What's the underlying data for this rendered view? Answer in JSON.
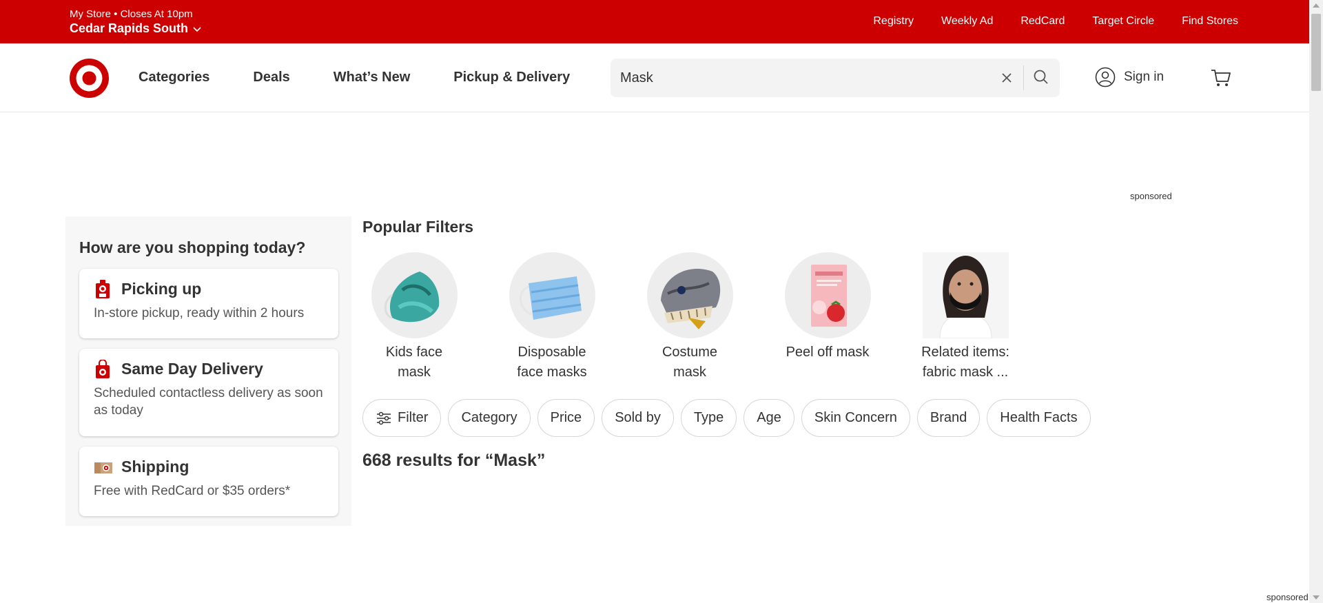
{
  "store": {
    "line1": "My Store • Closes At 10pm",
    "name": "Cedar Rapids South"
  },
  "utility_links": [
    "Registry",
    "Weekly Ad",
    "RedCard",
    "Target Circle",
    "Find Stores"
  ],
  "nav": {
    "items": [
      "Categories",
      "Deals",
      "What’s New",
      "Pickup & Delivery"
    ]
  },
  "search": {
    "value": "Mask"
  },
  "account": {
    "signin_label": "Sign in"
  },
  "sponsored": {
    "top": "sponsored",
    "bottom": "sponsored"
  },
  "shopping": {
    "title": "How are you shopping today?",
    "options": [
      {
        "title": "Picking up",
        "desc": "In-store pickup, ready within 2 hours"
      },
      {
        "title": "Same Day Delivery",
        "desc": "Scheduled contactless delivery as soon as today"
      },
      {
        "title": "Shipping",
        "desc": "Free with RedCard or $35 orders*"
      }
    ]
  },
  "popular_filters": {
    "title": "Popular Filters",
    "items": [
      {
        "label_line1": "Kids face",
        "label_line2": "mask"
      },
      {
        "label_line1": "Disposable",
        "label_line2": "face masks"
      },
      {
        "label_line1": "Costume",
        "label_line2": "mask"
      },
      {
        "label_line1": "Peel off mask",
        "label_line2": ""
      },
      {
        "label_line1": "Related items:",
        "label_line2": "fabric mask ..."
      }
    ]
  },
  "filter_chips": [
    "Filter",
    "Category",
    "Price",
    "Sold by",
    "Type",
    "Age",
    "Skin Concern",
    "Brand",
    "Health Facts"
  ],
  "results_text": "668 results for “Mask”",
  "colors": {
    "brand_red": "#cc0000",
    "text": "#333333",
    "panel_bg": "#f7f7f7"
  }
}
